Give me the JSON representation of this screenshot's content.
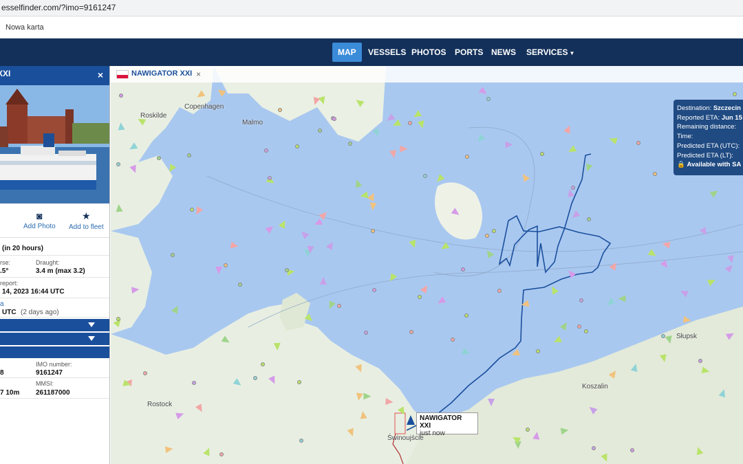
{
  "browser": {
    "url": "esselfinder.com/?imo=9161247",
    "bookmark": "Nowa karta"
  },
  "nav": [
    {
      "label": "MAP",
      "active": true
    },
    {
      "label": "VESSELS"
    },
    {
      "label": "PHOTOS"
    },
    {
      "label": "PORTS"
    },
    {
      "label": "NEWS"
    },
    {
      "label": "SERVICES"
    }
  ],
  "panel": {
    "title": "XXI",
    "close": "×",
    "actions": {
      "add_photo": "Add Photo",
      "add_fleet": "Add to fleet"
    },
    "eta_note": "(in 20 hours)",
    "course_label": "rse:",
    "course_value": ".5°",
    "draught_label": "Draught:",
    "draught_value": "3.4 m (max 3.2)",
    "report_label": "report:",
    "report_value": "14, 2023 16:44 UTC",
    "pos_link": "a",
    "pos_time": "UTC",
    "pos_ago": "(2 days ago)",
    "imo_label": "IMO number:",
    "imo_value": "9161247",
    "year_value": "8",
    "mmsi_label": "MMSI:",
    "mmsi_value": "261187000",
    "size_value": "7 10m"
  },
  "map": {
    "tab_name": "NAWIGATOR XXI",
    "tab_close": "×",
    "info": {
      "dest_label": "Destination:",
      "dest_value": "Szczecin",
      "eta_label": "Reported ETA:",
      "eta_value": "Jun 15",
      "dist_label": "Remaining distance:",
      "time_label": "Time:",
      "putc_label": "Predicted ETA (UTC):",
      "plt_label": "Predicted ETA (LT):",
      "sat": "Available with SA"
    },
    "ship_label": {
      "name": "NAWIGATOR XXI",
      "status": "just now"
    },
    "cities": {
      "copenhagen": "Copenhagen",
      "roskilde": "Roskilde",
      "malmo": "Malmo",
      "slupsk": "Słupsk",
      "koszalin": "Koszalin",
      "rostock": "Rostock",
      "swinoujscie": "Świnoujście"
    }
  },
  "colors": {
    "navbar": "#13305a",
    "accent": "#3a8bd8",
    "panel_blue": "#1a4f9c",
    "track": "#1a4f9c"
  }
}
